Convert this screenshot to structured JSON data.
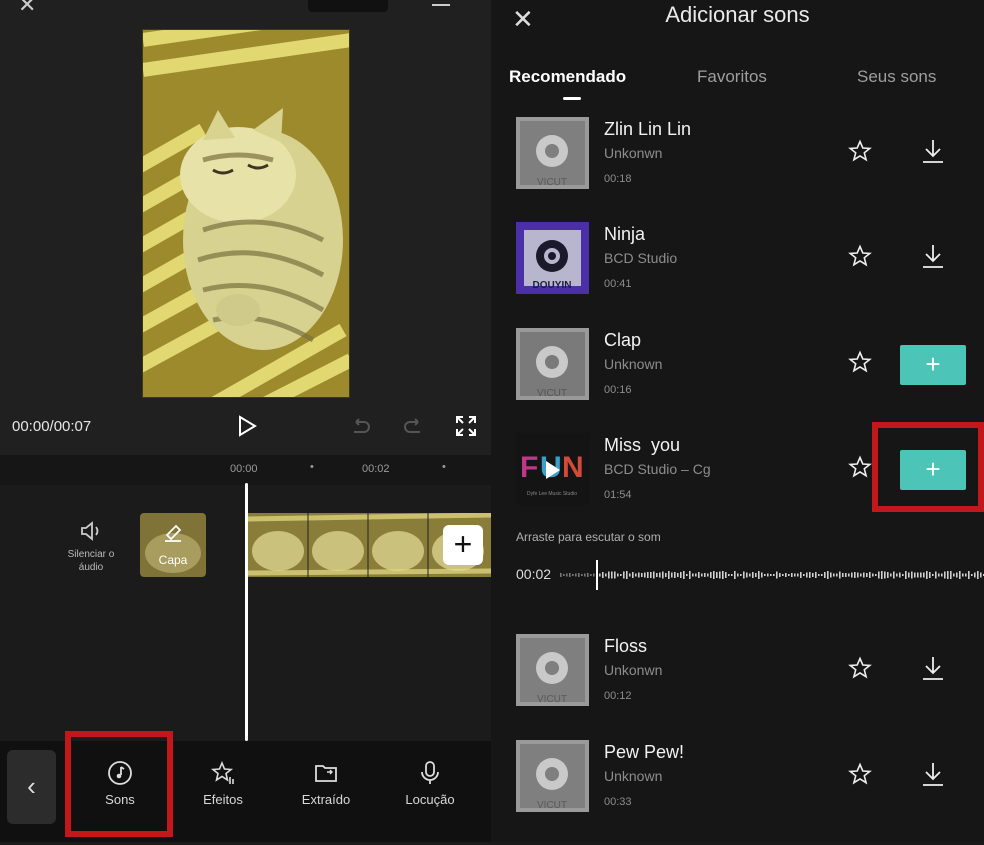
{
  "editor": {
    "timecode": "00:00/00:07",
    "ruler": [
      "00:00",
      "00:02"
    ],
    "mute_label": "Silenciar o áudio",
    "cover_label": "Capa",
    "toolbar": [
      "Sons",
      "Efeitos",
      "Extraído",
      "Locução"
    ]
  },
  "panel": {
    "title": "Adicionar sons",
    "tabs": [
      "Recomendado",
      "Favoritos",
      "Seus sons"
    ],
    "hint": "Arraste para escutar o som",
    "wave_time": "00:02",
    "tracks": [
      {
        "name": "Zlin Lin Lin",
        "artist": "Unkonwn",
        "duration": "00:18",
        "action": "download",
        "thumb_icon": "vicut-logo-icon"
      },
      {
        "name": "Ninja",
        "artist": "BCD Studio",
        "duration": "00:41",
        "action": "download",
        "thumb_icon": "douyin-logo-icon"
      },
      {
        "name": "Clap",
        "artist": "Unknown",
        "duration": "00:16",
        "action": "add",
        "thumb_icon": "vicut-logo-icon"
      },
      {
        "name": "Miss  you",
        "artist": "BCD Studio – Cg",
        "duration": "01:54",
        "action": "add",
        "thumb_icon": "fun-cover-icon"
      },
      {
        "name": "Floss",
        "artist": "Unkonwn",
        "duration": "00:12",
        "action": "download",
        "thumb_icon": "vicut-logo-icon"
      },
      {
        "name": "Pew Pew!",
        "artist": "Unknown",
        "duration": "00:33",
        "action": "download",
        "thumb_icon": "vicut-logo-icon"
      }
    ],
    "add_symbol": "+"
  },
  "colors": {
    "accent": "#4cc5b8",
    "highlight": "#c4171b"
  }
}
